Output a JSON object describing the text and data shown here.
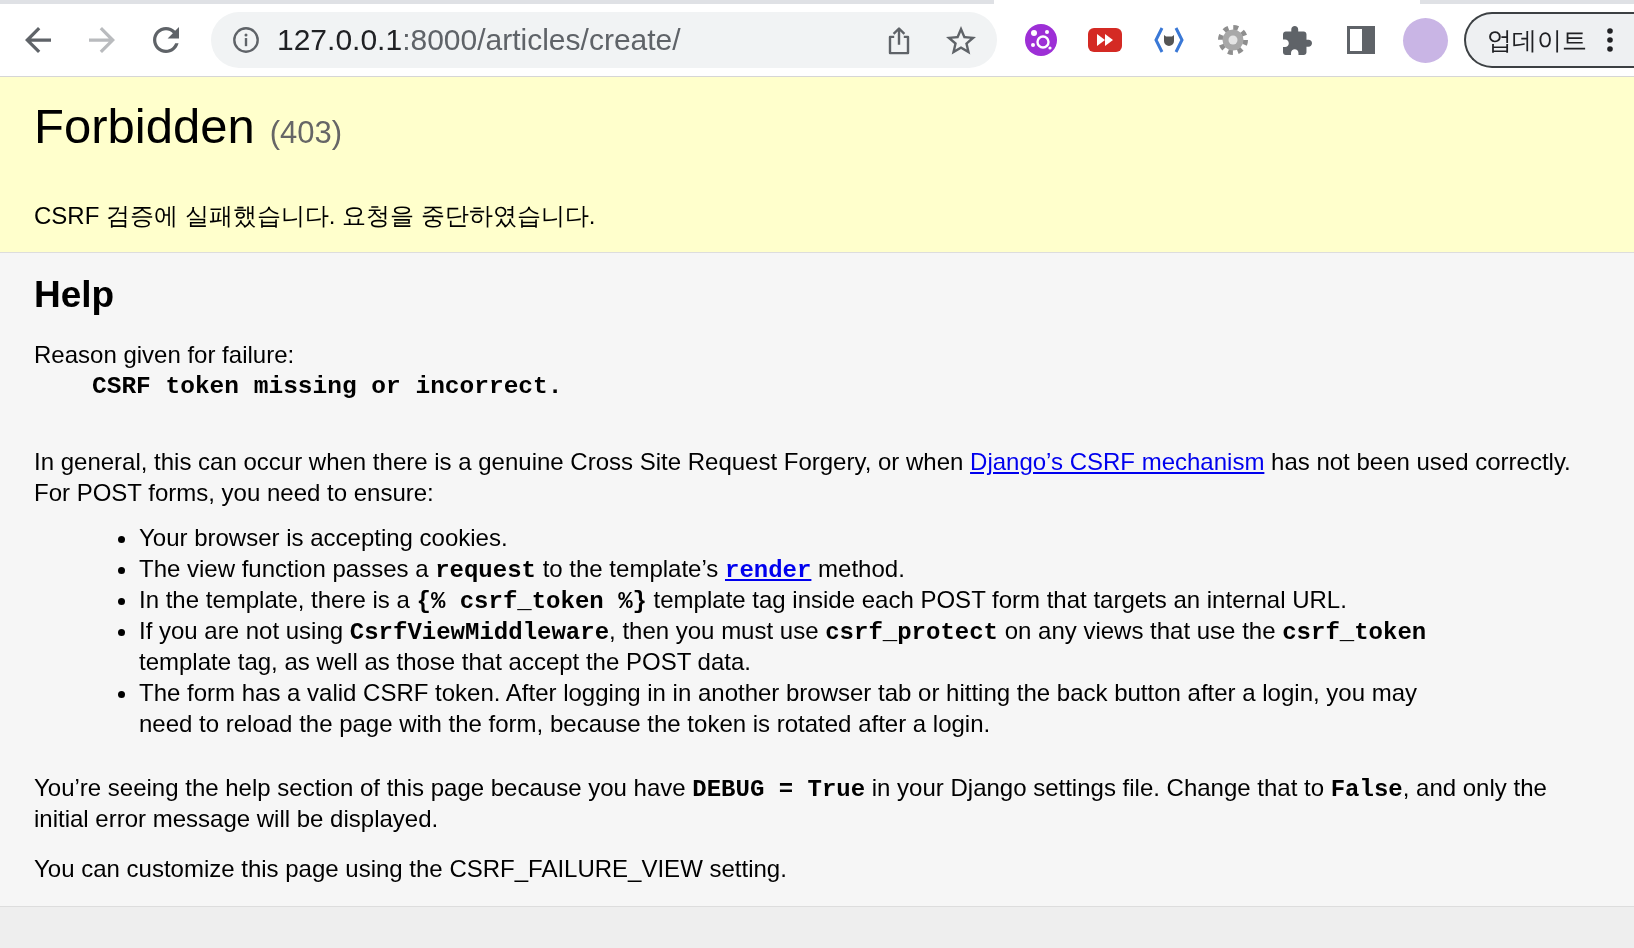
{
  "browser": {
    "nav_buttons": [
      {
        "kind": "back",
        "disabled": false
      },
      {
        "kind": "forward",
        "disabled": true
      },
      {
        "kind": "reload",
        "disabled": false
      }
    ],
    "address_bar": {
      "host": "127.0.0.1",
      "path": ":8000/articles/create/"
    },
    "update_button": {
      "label": "업데이트"
    }
  },
  "summary": {
    "title": "Forbidden",
    "status_code": "(403)",
    "message": "CSRF 검증에 실패했습니다. 요청을 중단하였습니다."
  },
  "help": {
    "heading": "Help",
    "reason_label": "Reason given for failure:",
    "reason": "CSRF token missing or incorrect.",
    "intro": {
      "lines": [
        [
          {
            "kind": "text",
            "text": "In general, this can occur when there is a genuine Cross Site Request Forgery, or when "
          },
          {
            "kind": "link",
            "text": "Django’s CSRF mechanism"
          },
          {
            "kind": "text",
            "text": " has not been used correctly."
          }
        ],
        [
          {
            "kind": "text",
            "text": "For POST forms, you need to ensure:"
          }
        ]
      ]
    },
    "checklist": [
      {
        "lines": [
          [
            {
              "kind": "text",
              "text": "Your browser is accepting cookies."
            }
          ]
        ]
      },
      {
        "lines": [
          [
            {
              "kind": "text",
              "text": "The view function passes a "
            },
            {
              "kind": "code",
              "text": "request"
            },
            {
              "kind": "text",
              "text": " to the template’s "
            },
            {
              "kind": "code-link",
              "text": "render"
            },
            {
              "kind": "text",
              "text": " method."
            }
          ]
        ]
      },
      {
        "lines": [
          [
            {
              "kind": "text",
              "text": "In the template, there is a "
            },
            {
              "kind": "code",
              "text": "{% csrf_token %}"
            },
            {
              "kind": "text",
              "text": " template tag inside each POST form that targets an internal URL."
            }
          ]
        ]
      },
      {
        "lines": [
          [
            {
              "kind": "text",
              "text": "If you are not using "
            },
            {
              "kind": "code",
              "text": "CsrfViewMiddleware"
            },
            {
              "kind": "text",
              "text": ", then you must use "
            },
            {
              "kind": "code",
              "text": "csrf_protect"
            },
            {
              "kind": "text",
              "text": " on any views that use the "
            },
            {
              "kind": "code",
              "text": "csrf_token"
            }
          ],
          [
            {
              "kind": "text",
              "text": "template tag, as well as those that accept the POST data."
            }
          ]
        ]
      },
      {
        "lines": [
          [
            {
              "kind": "text",
              "text": "The form has a valid CSRF token. After logging in in another browser tab or hitting the back button after a login, you may"
            }
          ],
          [
            {
              "kind": "text",
              "text": "need to reload the page with the form, because the token is rotated after a login."
            }
          ]
        ]
      }
    ],
    "debug_note": {
      "lines": [
        [
          {
            "kind": "text",
            "text": "You’re seeing the help section of this page because you have "
          },
          {
            "kind": "code",
            "text": "DEBUG = True"
          },
          {
            "kind": "text",
            "text": " in your Django settings file. Change that to "
          },
          {
            "kind": "code",
            "text": "False"
          },
          {
            "kind": "text",
            "text": ", and only the"
          }
        ],
        [
          {
            "kind": "text",
            "text": "initial error message will be displayed."
          }
        ]
      ]
    },
    "customize_note": {
      "lines": [
        [
          {
            "kind": "text",
            "text": "You can customize this page using the CSRF_FAILURE_VIEW setting."
          }
        ]
      ]
    }
  }
}
